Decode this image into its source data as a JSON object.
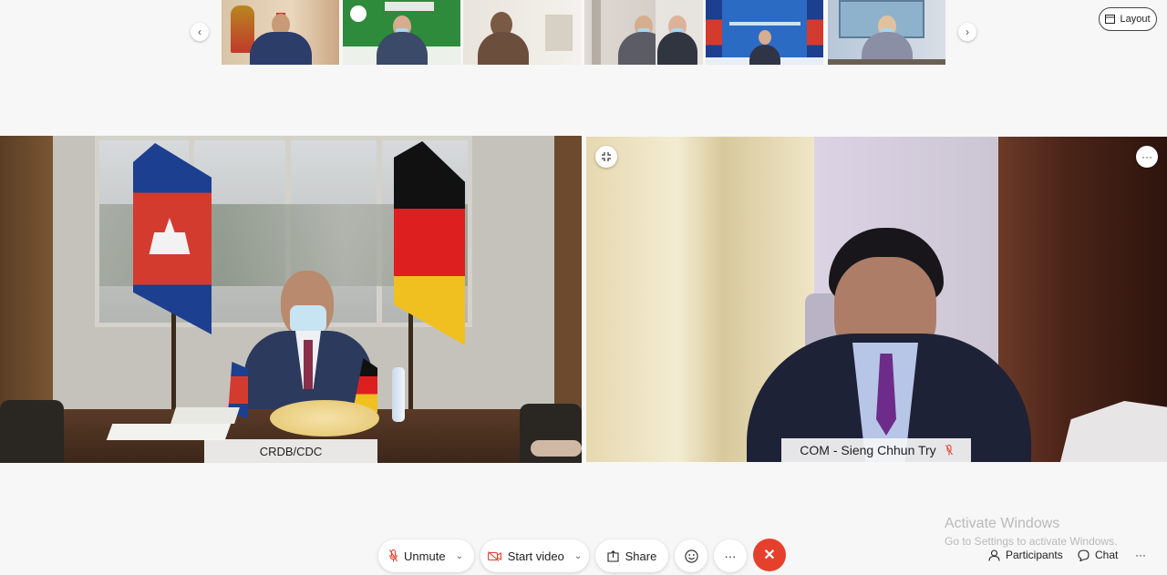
{
  "filmstrip": {
    "prev_icon": "chevron-left-icon",
    "next_icon": "chevron-right-icon",
    "prev_glyph": "‹",
    "next_glyph": "›"
  },
  "layout_button": {
    "label": "Layout",
    "icon": "layout-icon"
  },
  "tiles": [
    {
      "name": "CRDB/CDC"
    },
    {
      "name": "COM - Sieng Chhun Try",
      "mic_icon": "mic-off-icon",
      "expand_icon": "exit-fullscreen-icon",
      "more_icon": "more-horizontal-icon",
      "more_glyph": "···"
    }
  ],
  "toolbar": {
    "unmute_label": "Unmute",
    "start_video_label": "Start video",
    "share_label": "Share",
    "emoji_icon": "smiley-icon",
    "more_glyph": "···",
    "leave_glyph": "✕"
  },
  "right_controls": {
    "participants_label": "Participants",
    "chat_label": "Chat",
    "more_glyph": "···"
  },
  "watermark": {
    "title": "Activate Windows",
    "subtitle": "Go to Settings to activate Windows."
  },
  "colors": {
    "accent_red": "#e5402c",
    "mic_muted": "#e5402c"
  }
}
